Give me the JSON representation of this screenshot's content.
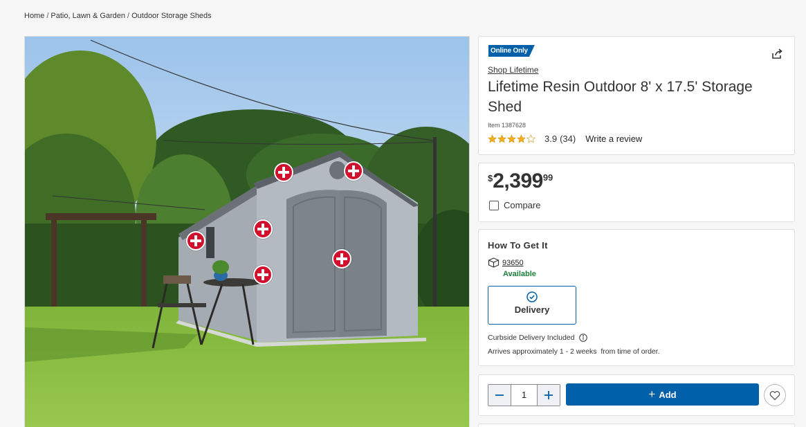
{
  "breadcrumb": {
    "items": [
      "Home",
      "Patio, Lawn & Garden",
      "Outdoor Storage Sheds"
    ],
    "separator": "/"
  },
  "product": {
    "badge": "Online Only",
    "brand_link": "Shop Lifetime",
    "title": "Lifetime Resin Outdoor 8' x 17.5' Storage Shed",
    "item_number": "Item 1387628",
    "rating": 3.9,
    "rating_text": "3.9",
    "review_count": "(34)",
    "write_review": "Write a review"
  },
  "price": {
    "currency": "$",
    "whole": "2,399",
    "cents": "99"
  },
  "compare_label": "Compare",
  "how_to_get": {
    "title": "How To Get It",
    "zip": "93650",
    "status": "Available",
    "delivery_label": "Delivery",
    "curbside": "Curbside Delivery Included",
    "arrives": "Arrives approximately 1 - 2 weeks  from time of order."
  },
  "cart": {
    "quantity": "1",
    "add_label": "Add"
  },
  "colors": {
    "primary": "#0060a9",
    "available_green": "#1a7f37",
    "hotspot_red": "#d0102c",
    "star_gold": "#f2b01e"
  },
  "icons": [
    "share-icon",
    "star-icon",
    "box-icon",
    "check-circle-icon",
    "info-icon",
    "minus-icon",
    "plus-icon",
    "heart-icon",
    "hotspot-plus-icon"
  ]
}
